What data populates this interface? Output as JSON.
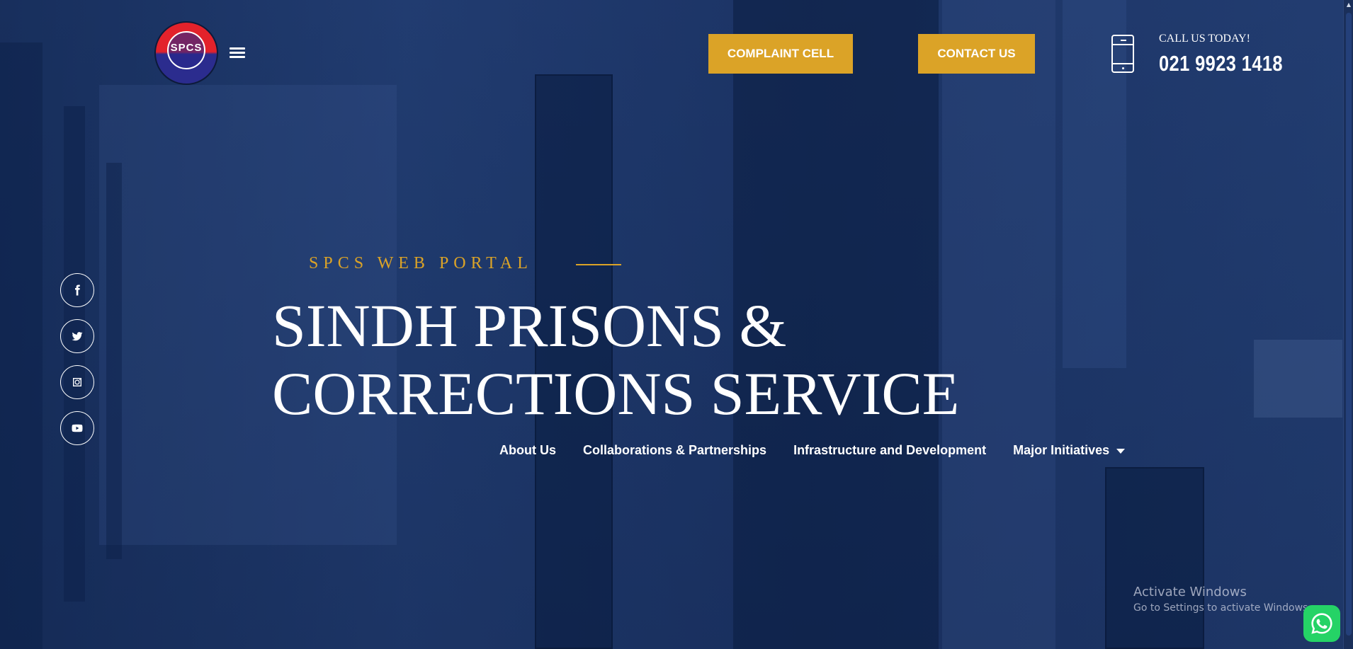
{
  "header": {
    "logo_text": "SPCS",
    "complaint_button": "COMPLAINT CELL",
    "contact_button": "CONTACT US",
    "call_label": "CALL US TODAY!",
    "call_number": "021 9923 1418"
  },
  "social": [
    {
      "name": "facebook-icon"
    },
    {
      "name": "twitter-icon"
    },
    {
      "name": "instagram-icon"
    },
    {
      "name": "youtube-icon"
    }
  ],
  "hero": {
    "eyebrow": "SPCS WEB PORTAL",
    "title_line1": "SINDH PRISONS &",
    "title_line2": "CORRECTIONS SERVICE"
  },
  "nav": {
    "items": [
      {
        "label": "About Us"
      },
      {
        "label": "Collaborations & Partnerships"
      },
      {
        "label": "Infrastructure and Development"
      },
      {
        "label": "Major Initiatives"
      }
    ]
  },
  "watermark": {
    "title": "Activate Windows",
    "subtitle": "Go to Settings to activate Windows."
  },
  "colors": {
    "accent": "#dba327",
    "background": "#1d3566",
    "whatsapp": "#25d366"
  }
}
